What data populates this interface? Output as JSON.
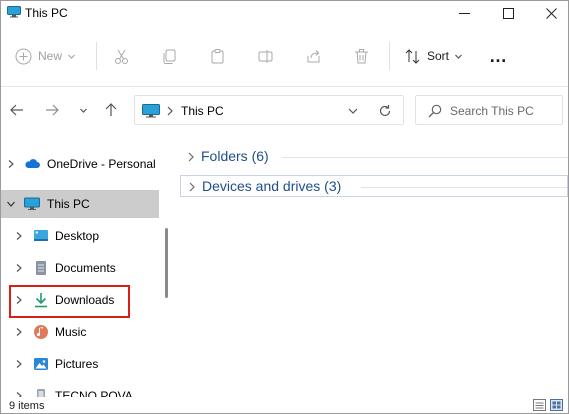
{
  "window": {
    "title": "This PC"
  },
  "toolbar": {
    "new_label": "New",
    "sort_label": "Sort",
    "more_label": "…"
  },
  "address": {
    "path": "This PC"
  },
  "search": {
    "placeholder": "Search This PC"
  },
  "nav": {
    "items": [
      {
        "label": "OneDrive - Personal"
      },
      {
        "label": "This PC"
      },
      {
        "label": "Desktop"
      },
      {
        "label": "Documents"
      },
      {
        "label": "Downloads"
      },
      {
        "label": "Music"
      },
      {
        "label": "Pictures"
      },
      {
        "label": "TECNO POVA"
      }
    ]
  },
  "content": {
    "groups": [
      {
        "label": "Folders (6)"
      },
      {
        "label": "Devices and drives (3)"
      }
    ]
  },
  "status": {
    "count": "9 items"
  },
  "colors": {
    "highlight": "#d91e18",
    "group_text": "#1f4e8c",
    "selected_bg": "#cccccc",
    "downloads_icon": "#1f9d6b"
  }
}
